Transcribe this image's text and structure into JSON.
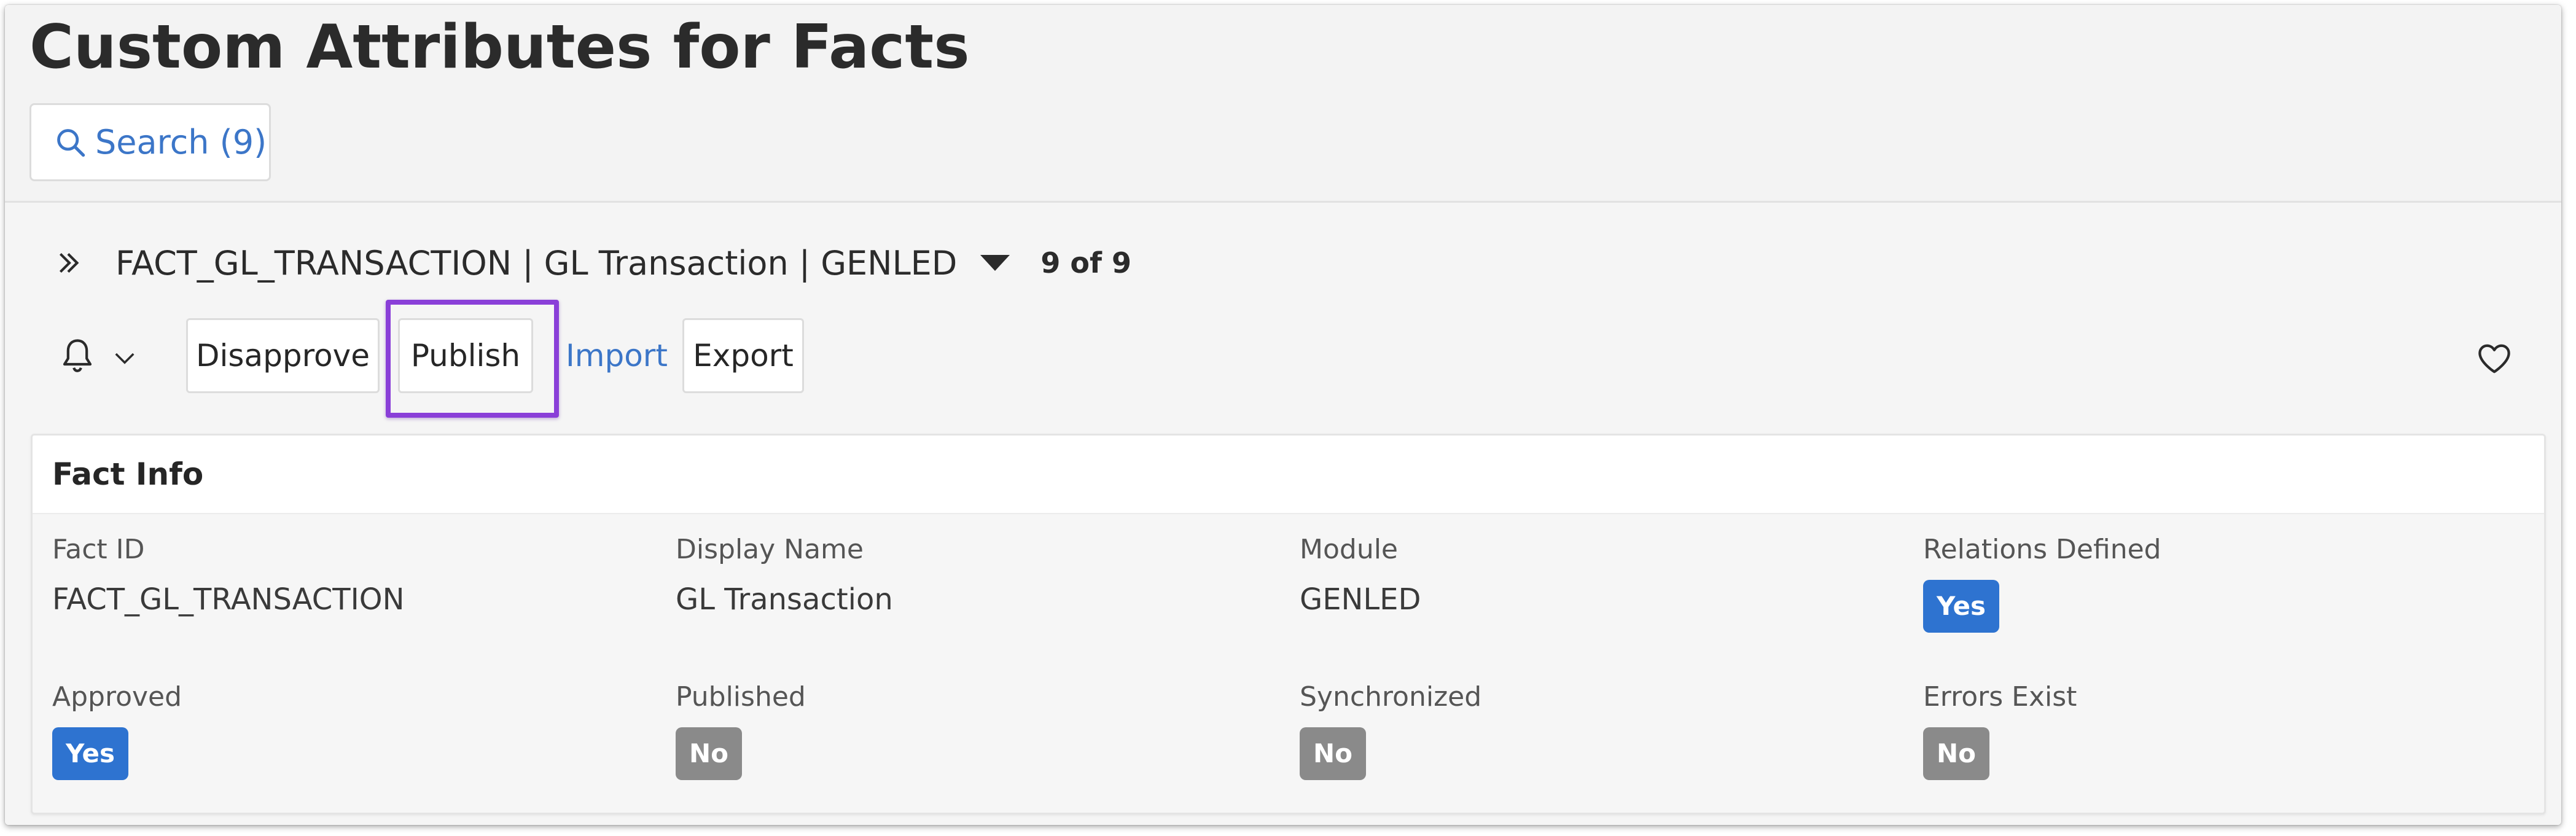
{
  "page": {
    "title": "Custom Attributes for Facts"
  },
  "search": {
    "label": "Search (9)"
  },
  "record": {
    "title": "FACT_GL_TRANSACTION | GL Transaction | GENLED",
    "count": "9 of 9"
  },
  "toolbar": {
    "disapprove": "Disapprove",
    "publish": "Publish",
    "import": "Import",
    "export": "Export"
  },
  "fact_info": {
    "header": "Fact Info",
    "fields": [
      {
        "label": "Fact ID",
        "value": "FACT_GL_TRANSACTION"
      },
      {
        "label": "Display Name",
        "value": "GL Transaction"
      },
      {
        "label": "Module",
        "value": "GENLED"
      },
      {
        "label": "Relations Defined",
        "value": "Yes"
      },
      {
        "label": "Approved",
        "value": "Yes"
      },
      {
        "label": "Published",
        "value": "No"
      },
      {
        "label": "Synchronized",
        "value": "No"
      },
      {
        "label": "Errors Exist",
        "value": "No"
      }
    ]
  },
  "colors": {
    "accent_blue": "#3c76c8",
    "badge_yes": "#2e73d0",
    "badge_no": "#8a8a8a",
    "highlight": "#8a3fd8"
  }
}
